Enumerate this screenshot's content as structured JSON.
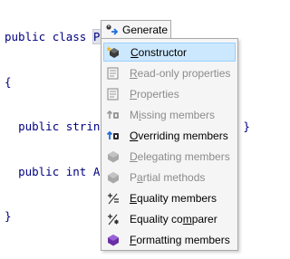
{
  "code": {
    "line1": {
      "kw1": "public",
      "kw2": "class",
      "ident": "Person"
    },
    "line2": "{",
    "line3": {
      "kw1": "public",
      "type": "string",
      "rest": "get; set; }"
    },
    "line4": {
      "kw1": "public",
      "type": "int",
      "name": "Ag"
    },
    "line5": "}"
  },
  "popup": {
    "header_label": "Generate",
    "items": [
      {
        "label_before": "",
        "mnemonic": "C",
        "label_after": "onstructor",
        "icon": "constructor-icon",
        "enabled": true,
        "selected": true
      },
      {
        "label_before": "",
        "mnemonic": "R",
        "label_after": "ead-only properties",
        "icon": "readonly-properties-icon",
        "enabled": false,
        "selected": false
      },
      {
        "label_before": "",
        "mnemonic": "P",
        "label_after": "roperties",
        "icon": "properties-icon",
        "enabled": false,
        "selected": false
      },
      {
        "label_before": "M",
        "mnemonic": "i",
        "label_after": "ssing members",
        "icon": "missing-members-icon",
        "enabled": false,
        "selected": false
      },
      {
        "label_before": "",
        "mnemonic": "O",
        "label_after": "verriding members",
        "icon": "overriding-members-icon",
        "enabled": true,
        "selected": false
      },
      {
        "label_before": "",
        "mnemonic": "D",
        "label_after": "elegating members",
        "icon": "delegating-members-icon",
        "enabled": false,
        "selected": false
      },
      {
        "label_before": "P",
        "mnemonic": "a",
        "label_after": "rtial methods",
        "icon": "partial-methods-icon",
        "enabled": false,
        "selected": false
      },
      {
        "label_before": "",
        "mnemonic": "E",
        "label_after": "quality members",
        "icon": "equality-members-icon",
        "enabled": true,
        "selected": false
      },
      {
        "label_before": "Equality co",
        "mnemonic": "m",
        "label_after": "parer",
        "icon": "equality-comparer-icon",
        "enabled": true,
        "selected": false
      },
      {
        "label_before": "",
        "mnemonic": "F",
        "label_after": "ormatting members",
        "icon": "formatting-members-icon",
        "enabled": true,
        "selected": false
      }
    ]
  },
  "colors": {
    "selection_bg": "#cce8ff",
    "selection_border": "#99d1ff",
    "code_keyword": "#000080",
    "disabled_text": "#8c8c8c",
    "accent_purple": "#7b3fb5"
  }
}
